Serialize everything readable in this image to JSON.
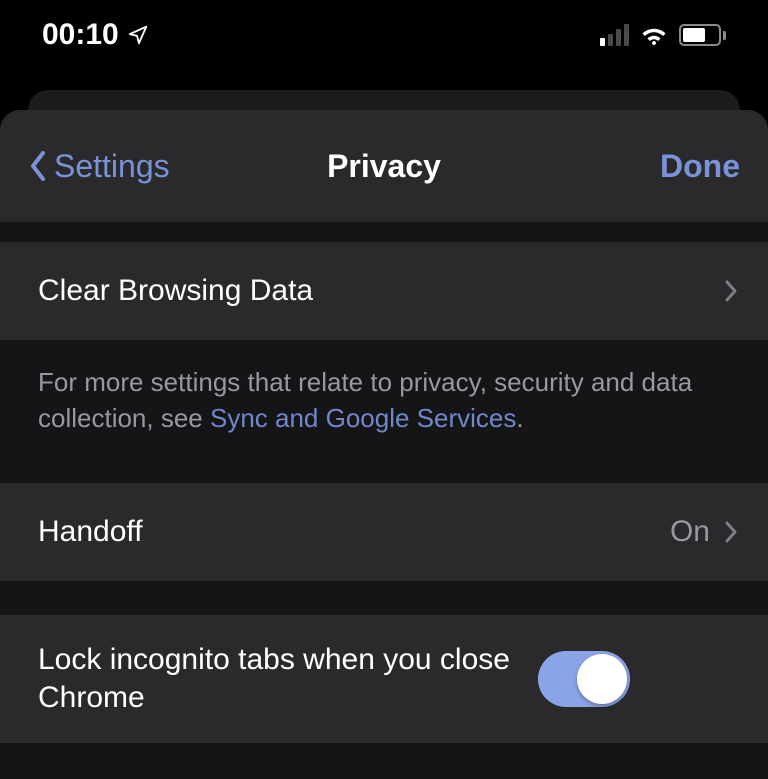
{
  "status_bar": {
    "time": "00:10"
  },
  "nav": {
    "back_label": "Settings",
    "title": "Privacy",
    "done_label": "Done"
  },
  "cells": {
    "clear_browsing_data": "Clear Browsing Data",
    "footer_text_prefix": "For more settings that relate to privacy, security and data collection, see ",
    "footer_link": "Sync and Google Services",
    "footer_text_suffix": ".",
    "handoff_label": "Handoff",
    "handoff_value": "On",
    "lock_incognito_label": "Lock incognito tabs when you close Chrome",
    "lock_incognito_on": true
  }
}
